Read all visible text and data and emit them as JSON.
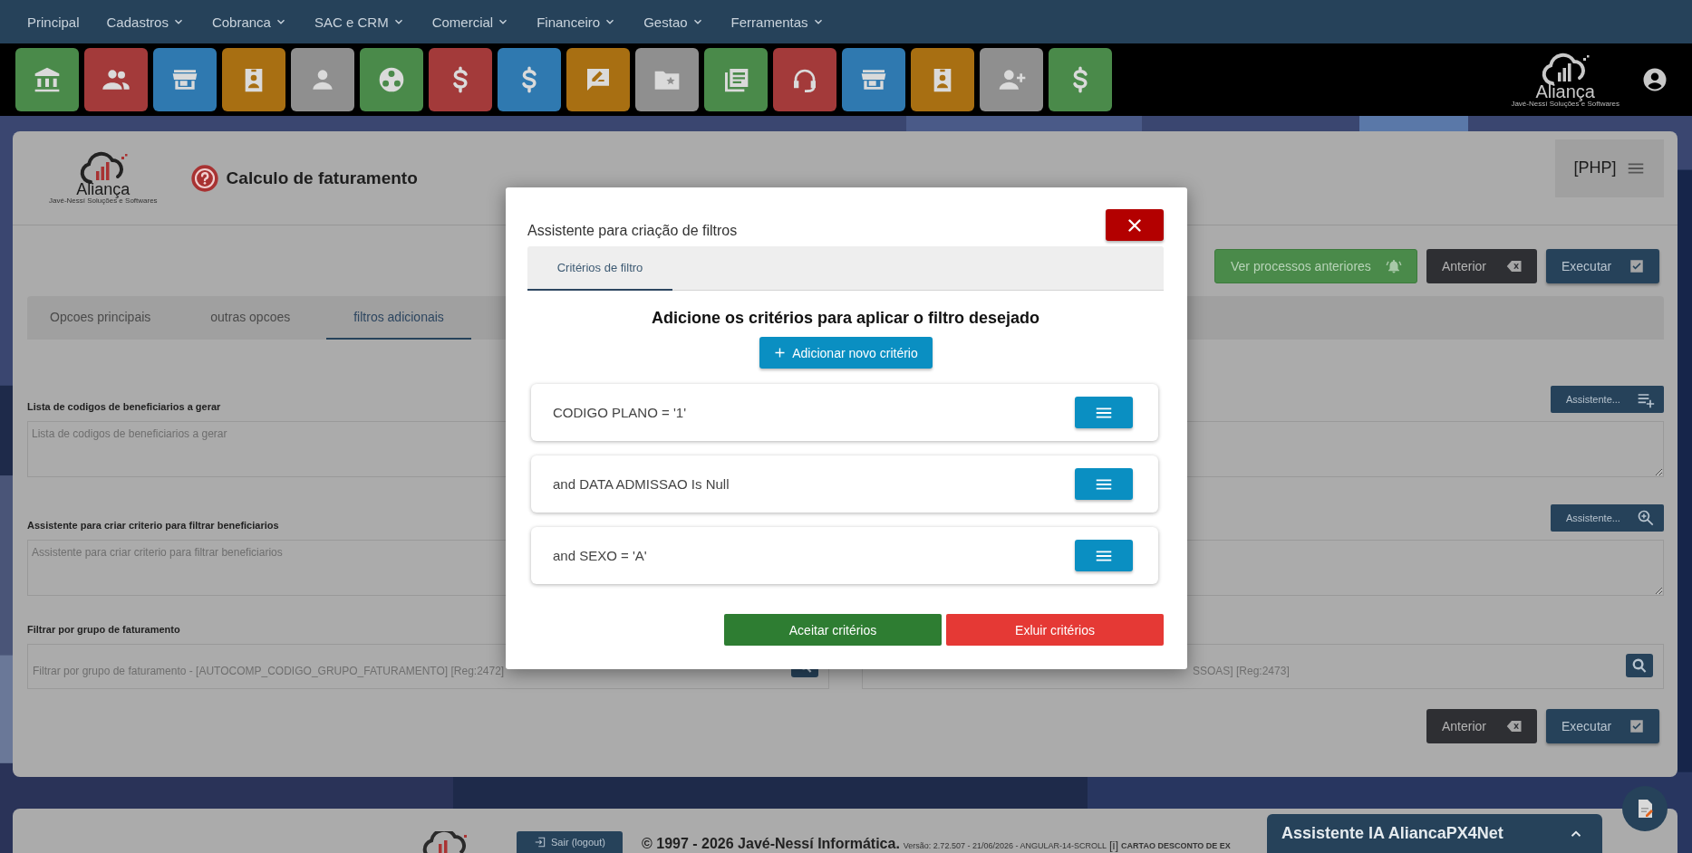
{
  "nav": {
    "items": [
      {
        "label": "Principal",
        "dropdown": false
      },
      {
        "label": "Cadastros",
        "dropdown": true
      },
      {
        "label": "Cobranca",
        "dropdown": true
      },
      {
        "label": "SAC e CRM",
        "dropdown": true
      },
      {
        "label": "Comercial",
        "dropdown": true
      },
      {
        "label": "Financeiro",
        "dropdown": true
      },
      {
        "label": "Gestao",
        "dropdown": true
      },
      {
        "label": "Ferramentas",
        "dropdown": true
      }
    ]
  },
  "toolbar": {
    "tiles": [
      {
        "kind": "bank",
        "color": "#4a8a4a"
      },
      {
        "kind": "people",
        "color": "#a33a3a"
      },
      {
        "kind": "store",
        "color": "#2f79b0"
      },
      {
        "kind": "badge",
        "color": "#a86f12"
      },
      {
        "kind": "person",
        "color": "#8f8f8f"
      },
      {
        "kind": "reel",
        "color": "#4a8a4a"
      },
      {
        "kind": "dollar",
        "color": "#a33a3a"
      },
      {
        "kind": "dollar",
        "color": "#2f79b0"
      },
      {
        "kind": "note",
        "color": "#a86f12"
      },
      {
        "kind": "folder",
        "color": "#8f8f8f"
      },
      {
        "kind": "news",
        "color": "#4a8a4a"
      },
      {
        "kind": "headset",
        "color": "#a33a3a"
      },
      {
        "kind": "store",
        "color": "#2f79b0"
      },
      {
        "kind": "badge",
        "color": "#a86f12"
      },
      {
        "kind": "person_add",
        "color": "#8f8f8f"
      },
      {
        "kind": "dollar",
        "color": "#4a8a4a"
      }
    ],
    "brand": {
      "name": "Aliança",
      "tagline": "Javé-Nessí Soluções e Softwares"
    }
  },
  "page": {
    "brand": {
      "name": "Aliança",
      "tagline": "Javé-Nessí Soluções e Softwares"
    },
    "title": "Calculo de faturamento",
    "menu_label": "[PHP]",
    "actions": [
      {
        "label": "Ver processos anteriores",
        "kind": "history"
      },
      {
        "label": "Anterior",
        "kind": "back"
      },
      {
        "label": "Executar",
        "kind": "run"
      }
    ],
    "tabs": [
      {
        "label": "Opcoes principais",
        "selected": false
      },
      {
        "label": "outras opcoes",
        "selected": false
      },
      {
        "label": "filtros adicionais",
        "selected": true
      }
    ],
    "fields": [
      {
        "label": "Lista de codigos de beneficiarios a gerar",
        "placeholder": "Lista de codigos de beneficiarios a gerar",
        "assistant": {
          "label": "Assistente...",
          "kind": "list_add"
        }
      },
      {
        "label": "Assistente para criar criterio para filtrar beneficiarios",
        "placeholder": "Assistente para criar criterio para filtrar beneficiarios",
        "assistant": {
          "label": "Assistente...",
          "kind": "zoom"
        }
      }
    ],
    "group_filter": {
      "label": "Filtrar por grupo de faturamento",
      "inputs": [
        {
          "placeholder": "Filtrar por grupo de faturamento - [AUTOCOMP_CODIGO_GRUPO_FATURAMENTO] [Reg:2472]"
        },
        {
          "placeholder": "SSOAS] [Reg:2473]"
        }
      ]
    },
    "bottom_actions": [
      {
        "label": "Anterior",
        "kind": "back"
      },
      {
        "label": "Executar",
        "kind": "run"
      }
    ]
  },
  "footer": {
    "logout": "Sair (logout)",
    "copyright": "© 1997 - 2026 Javé-Nessí Informática.",
    "version": "Versão: 2.72.507 - 21/06/2026 - ANGULAR-14-SCROLL",
    "info": "[i]",
    "client": "CARTAO DESCONTO DE EX"
  },
  "ai_panel": {
    "title": "Assistente IA AliancaPX4Net"
  },
  "modal": {
    "title": "Assistente para criação de filtros",
    "tabs": [
      {
        "label": "Critérios de filtro",
        "selected": true
      }
    ],
    "heading": "Adicione os critérios para aplicar o filtro desejado",
    "add_button": "Adicionar novo critério",
    "criteria": [
      {
        "text": "CODIGO PLANO = '1'"
      },
      {
        "text": "and DATA ADMISSAO Is Null"
      },
      {
        "text": "and SEXO = 'A'"
      }
    ],
    "buttons": [
      {
        "label": "Aceitar critérios",
        "kind": "accept"
      },
      {
        "label": "Exluir critérios",
        "kind": "delete"
      }
    ]
  }
}
